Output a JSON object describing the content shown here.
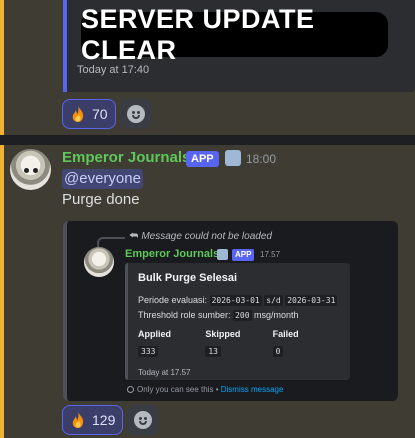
{
  "previous_message": {
    "banner_text": "SERVER UPDATE CLEAR",
    "timestamp": "Today at 17:40",
    "reactions": [
      {
        "emoji": "fire-emoji",
        "count": "70"
      }
    ]
  },
  "message": {
    "author": "Emperor Journals",
    "app_badge": "APP",
    "time": "18:00",
    "mention": "@everyone",
    "text": "Purge done",
    "reactions": [
      {
        "emoji": "fire-emoji",
        "count": "129"
      }
    ]
  },
  "screenshot": {
    "reply_notice": "Message could not be loaded",
    "author": "Emperor Journals",
    "app_badge": "APP",
    "time": "17.57",
    "card": {
      "title": "Bulk Purge Selesai",
      "period_label": "Periode evaluasi:",
      "period_start": "2026-03-01",
      "period_sep": "s/d",
      "period_end": "2026-03-31",
      "threshold_label": "Threshold role sumber:",
      "threshold_value": "200",
      "threshold_unit": "msg/month",
      "fields": [
        {
          "label": "Applied",
          "value": "333"
        },
        {
          "label": "Skipped",
          "value": "13"
        },
        {
          "label": "Failed",
          "value": "0"
        }
      ],
      "timestamp": "Today at 17.57"
    },
    "ephemeral_text": "Only you can see this •",
    "dismiss_text": "Dismiss message"
  },
  "colors": {
    "mention_highlight": "#3f3c33",
    "mention_bar": "#f0b232",
    "username": "#5ec85a",
    "blurple": "#5865f2",
    "link": "#00a8fc"
  }
}
